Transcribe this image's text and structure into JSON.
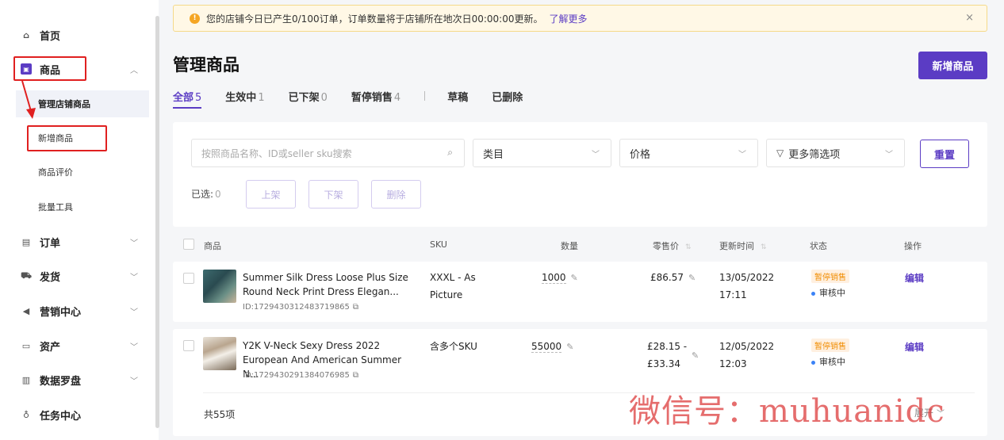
{
  "sidebar": {
    "items": [
      {
        "label": "首页",
        "icon": "home-icon"
      },
      {
        "label": "商品",
        "icon": "product-icon",
        "expanded": true
      },
      {
        "label": "订单",
        "icon": "order-icon"
      },
      {
        "label": "发货",
        "icon": "truck-icon"
      },
      {
        "label": "营销中心",
        "icon": "megaphone-icon"
      },
      {
        "label": "资产",
        "icon": "wallet-icon"
      },
      {
        "label": "数据罗盘",
        "icon": "chart-icon"
      },
      {
        "label": "任务中心",
        "icon": "medal-icon"
      }
    ],
    "sub_items": [
      {
        "label": "管理店铺商品",
        "active": true
      },
      {
        "label": "新增商品"
      },
      {
        "label": "商品评价"
      },
      {
        "label": "批量工具"
      }
    ]
  },
  "notice": {
    "text": "您的店铺今日已产生0/100订单，订单数量将于店铺所在地次日00:00:00更新。",
    "link": "了解更多",
    "close": "×"
  },
  "page": {
    "title": "管理商品",
    "add_button": "新增商品"
  },
  "tabs": [
    {
      "label": "全部",
      "count": "5",
      "active": true
    },
    {
      "label": "生效中",
      "count": "1"
    },
    {
      "label": "已下架",
      "count": "0"
    },
    {
      "label": "暂停销售",
      "count": "4"
    },
    {
      "label": "草稿",
      "count": ""
    },
    {
      "label": "已删除",
      "count": ""
    }
  ],
  "filters": {
    "search_placeholder": "按照商品名称、ID或seller sku搜索",
    "category": "类目",
    "price": "价格",
    "more": "更多筛选项",
    "reset": "重置",
    "selected_label": "已选:",
    "selected_count": "0",
    "bulk_actions": [
      "上架",
      "下架",
      "删除"
    ]
  },
  "table": {
    "headers": [
      "商品",
      "SKU",
      "数量",
      "零售价",
      "更新时间",
      "状态",
      "操作"
    ],
    "rows": [
      {
        "name": "Summer Silk Dress Loose Plus Size Round Neck Print Dress Elegan...",
        "id": "ID:1729430312483719865",
        "sku": "XXXL - As Picture",
        "quantity": "1000",
        "price": "£86.57",
        "date": "13/05/2022",
        "time": "17:11",
        "status": "暂停销售",
        "review": "审核中",
        "action": "编辑"
      },
      {
        "name": "Y2K V-Neck Sexy Dress 2022 European And American Summer N...",
        "id": "ID:1729430291384076985",
        "sku": "含多个SKU",
        "quantity": "55000",
        "price": "£28.15 -",
        "price2": "£33.34",
        "date": "12/05/2022",
        "time": "12:03",
        "status": "暂停销售",
        "review": "审核中",
        "action": "编辑"
      }
    ],
    "total": "共55项",
    "expand": "展开"
  },
  "watermark": "微信号：muhuanidc",
  "colors": {
    "accent": "#5b3cc4",
    "warning": "#f5a623",
    "status_orange": "#f08c00",
    "annotation_red": "#e02020"
  }
}
